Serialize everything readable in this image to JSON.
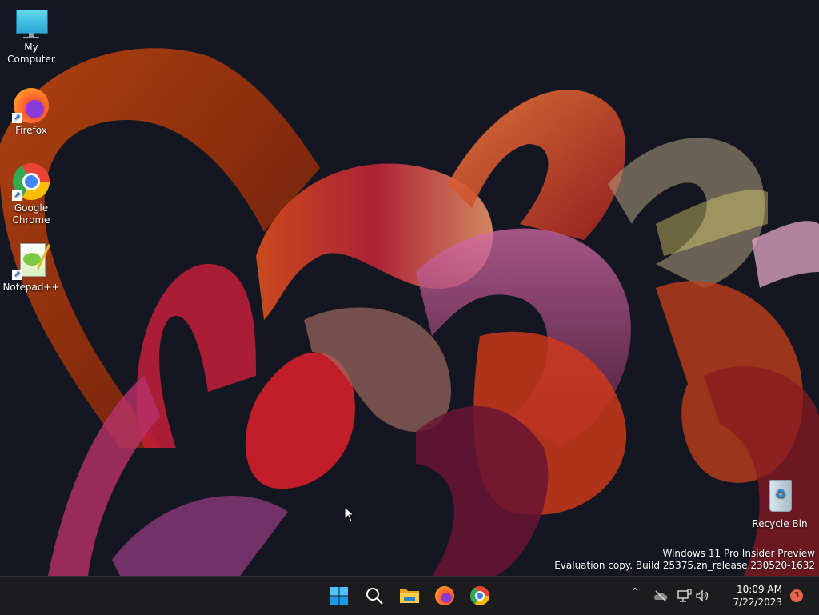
{
  "desktop": {
    "icons": [
      {
        "label": "My Computer",
        "icon": "monitor-icon",
        "shortcut": false
      },
      {
        "label": "Firefox",
        "icon": "firefox-icon",
        "shortcut": true
      },
      {
        "label": "Google Chrome",
        "icon": "chrome-icon",
        "shortcut": true
      },
      {
        "label": "Notepad++",
        "icon": "notepadpp-icon",
        "shortcut": true
      }
    ],
    "recycle_bin": {
      "label": "Recycle Bin",
      "icon": "recycle-bin-icon"
    },
    "watermark": {
      "line1": "Windows 11 Pro Insider Preview",
      "line2": "Evaluation copy. Build 25375.zn_release.230520-1632"
    }
  },
  "taskbar": {
    "apps": [
      {
        "name": "Start",
        "icon": "windows-start-icon"
      },
      {
        "name": "Search",
        "icon": "search-icon"
      },
      {
        "name": "File Explorer",
        "icon": "folder-icon"
      },
      {
        "name": "Firefox",
        "icon": "firefox-icon"
      },
      {
        "name": "Google Chrome",
        "icon": "chrome-icon"
      }
    ],
    "tray": {
      "icons": [
        "chevron-up-icon",
        "onedrive-offline-icon",
        "network-icon",
        "volume-icon"
      ],
      "time": "10:09 AM",
      "date": "7/22/2023",
      "notification_count": "3"
    }
  },
  "colors": {
    "taskbar": "#1c1c1f",
    "accent": "#0078d4",
    "badge": "#e8654e"
  }
}
